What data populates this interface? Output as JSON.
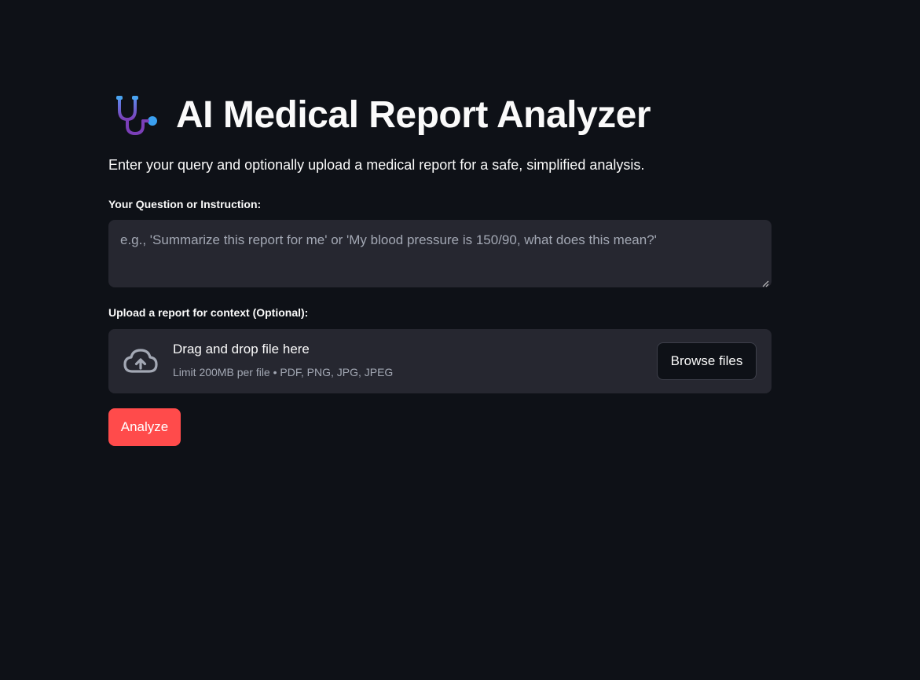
{
  "header": {
    "title": "AI Medical Report Analyzer",
    "icon": "stethoscope-icon"
  },
  "intro": {
    "subtitle": "Enter your query and optionally upload a medical report for a safe, simplified analysis."
  },
  "query": {
    "label": "Your Question or Instruction:",
    "value": "",
    "placeholder": "e.g., 'Summarize this report for me' or 'My blood pressure is 150/90, what does this mean?'"
  },
  "upload": {
    "label": "Upload a report for context (Optional):",
    "drop_text": "Drag and drop file here",
    "limit_text": "Limit 200MB per file • PDF, PNG, JPG, JPEG",
    "browse_label": "Browse files",
    "icon": "cloud-upload-icon"
  },
  "actions": {
    "analyze_label": "Analyze"
  },
  "colors": {
    "background": "#0e1117",
    "surface": "#262730",
    "primary": "#ff4b4b",
    "text": "#fafafa",
    "muted": "#a3a8b4"
  }
}
